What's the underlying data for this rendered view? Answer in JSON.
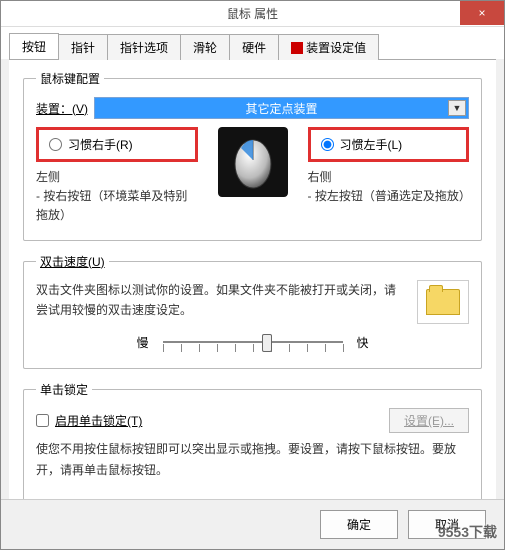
{
  "dialog": {
    "title": "鼠标 属性",
    "close_symbol": "×"
  },
  "tabs": {
    "items": [
      {
        "label": "按钮"
      },
      {
        "label": "指针"
      },
      {
        "label": "指针选项"
      },
      {
        "label": "滑轮"
      },
      {
        "label": "硬件"
      },
      {
        "label": "装置设定值"
      }
    ]
  },
  "buttons_group": {
    "legend": "鼠标键配置",
    "device_label": "装置：(V)",
    "device_value": "其它定点装置",
    "right_hand_label": "习惯右手(R)",
    "left_hand_label": "习惯左手(L)",
    "left_side_title": "左侧",
    "left_side_text": "- 按右按钮（环境菜单及特别拖放）",
    "right_side_title": "右侧",
    "right_side_text": "- 按左按钮（普通选定及拖放）"
  },
  "doubleclick": {
    "legend": "双击速度(U)",
    "help_text": "双击文件夹图标以测试你的设置。如果文件夹不能被打开或关闭，请尝试用较慢的双击速度设定。",
    "slow_label": "慢",
    "fast_label": "快"
  },
  "clicklock": {
    "legend": "单击锁定",
    "enable_label": "启用单击锁定(T)",
    "settings_button": "设置(E)...",
    "help_text": "使您不用按住鼠标按钮即可以突出显示或拖拽。要设置，请按下鼠标按钮。要放开，请再单击鼠标按钮。"
  },
  "footer": {
    "ok": "确定",
    "cancel": "取消"
  },
  "watermark": "9553下载"
}
